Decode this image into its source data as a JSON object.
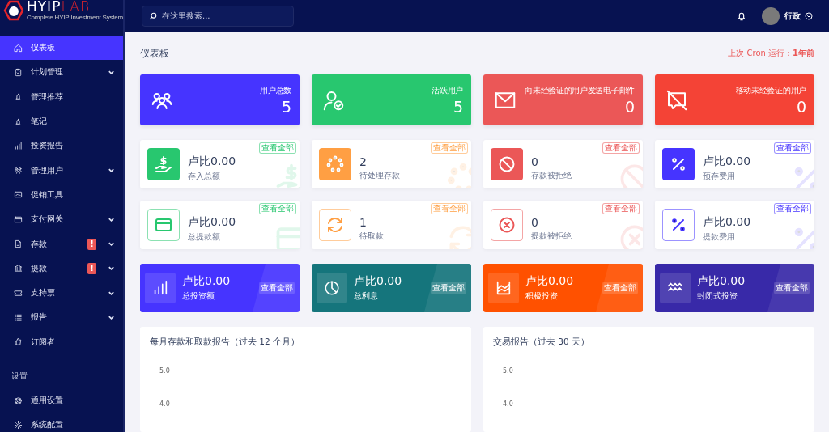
{
  "logo": {
    "name_a": "HYIP",
    "name_b": "LAB",
    "tagline": "Complete HYIP Investment System"
  },
  "search": {
    "placeholder": "在这里搜索..."
  },
  "user": {
    "name": "行政"
  },
  "sidebar": {
    "items": [
      {
        "label": "仪表板",
        "selected": true,
        "expandable": false
      },
      {
        "label": "计划管理",
        "selected": false,
        "expandable": true
      },
      {
        "label": "管理推荐",
        "selected": false,
        "expandable": false
      },
      {
        "label": "笔记",
        "selected": false,
        "expandable": false
      },
      {
        "label": "投资报告",
        "selected": false,
        "expandable": false
      },
      {
        "label": "管理用户",
        "selected": false,
        "expandable": true
      },
      {
        "label": "促销工具",
        "selected": false,
        "expandable": false
      },
      {
        "label": "支付网关",
        "selected": false,
        "expandable": true
      },
      {
        "label": "存款",
        "selected": false,
        "expandable": true,
        "badge": "!"
      },
      {
        "label": "提款",
        "selected": false,
        "expandable": true,
        "badge": "!"
      },
      {
        "label": "支持票",
        "selected": false,
        "expandable": true
      },
      {
        "label": "报告",
        "selected": false,
        "expandable": true
      },
      {
        "label": "订阅者",
        "selected": false,
        "expandable": false
      }
    ],
    "section": "设置",
    "settings_items": [
      {
        "label": "通用设置",
        "selected": false,
        "expandable": false
      },
      {
        "label": "系统配置",
        "selected": false,
        "expandable": false
      }
    ]
  },
  "page_title": "仪表板",
  "cron": {
    "label": "上次 Cron 运行：",
    "value": "1年前"
  },
  "stat_cards": [
    {
      "label": "用户总数",
      "value": "5",
      "color": "#4634ff"
    },
    {
      "label": "活跃用户",
      "value": "5",
      "color": "#28c76f"
    },
    {
      "label": "向未经验证的用户发送电子邮件",
      "value": "0",
      "color": "#eb5757"
    },
    {
      "label": "移动未经验证的用户",
      "value": "0",
      "color": "#f44336"
    }
  ],
  "widgets": [
    {
      "kind": "solid",
      "value": "卢比0.00",
      "label": "存入总额",
      "link": "查看全部",
      "color": "#28c76f"
    },
    {
      "kind": "solid",
      "value": "2",
      "label": "待处理存款",
      "link": "查看全部",
      "color": "#ff9f43"
    },
    {
      "kind": "solid",
      "value": "0",
      "label": "存款被拒绝",
      "link": "查看全部",
      "color": "#eb5757"
    },
    {
      "kind": "solid",
      "value": "卢比0.00",
      "label": "预存费用",
      "link": "查看全部",
      "color": "#4634ff"
    },
    {
      "kind": "outline",
      "value": "卢比0.00",
      "label": "总提款额",
      "link": "查看全部",
      "color": "#28c76f"
    },
    {
      "kind": "outline",
      "value": "1",
      "label": "待取款",
      "link": "查看全部",
      "color": "#ff9f43"
    },
    {
      "kind": "outline",
      "value": "0",
      "label": "提款被拒绝",
      "link": "查看全部",
      "color": "#eb5757"
    },
    {
      "kind": "outline",
      "value": "卢比0.00",
      "label": "提款费用",
      "link": "查看全部",
      "color": "#4634ff"
    }
  ],
  "invest_cards": [
    {
      "value": "卢比0.00",
      "label": "总投资额",
      "link": "查看全部",
      "color": "#4634ff"
    },
    {
      "value": "卢比0.00",
      "label": "总利息",
      "link": "查看全部",
      "color": "#15757c"
    },
    {
      "value": "卢比0.00",
      "label": "积极投资",
      "link": "查看全部",
      "color": "#ff5100"
    },
    {
      "value": "卢比0.00",
      "label": "封闭式投资",
      "link": "查看全部",
      "color": "#3829a8"
    }
  ],
  "reports": [
    {
      "title": "每月存款和取款报告（过去 12 个月）",
      "y_ticks": [
        "5.0",
        "4.0"
      ]
    },
    {
      "title": "交易报告（过去 30 天）",
      "y_ticks": [
        "5.0",
        "4.0"
      ]
    }
  ]
}
